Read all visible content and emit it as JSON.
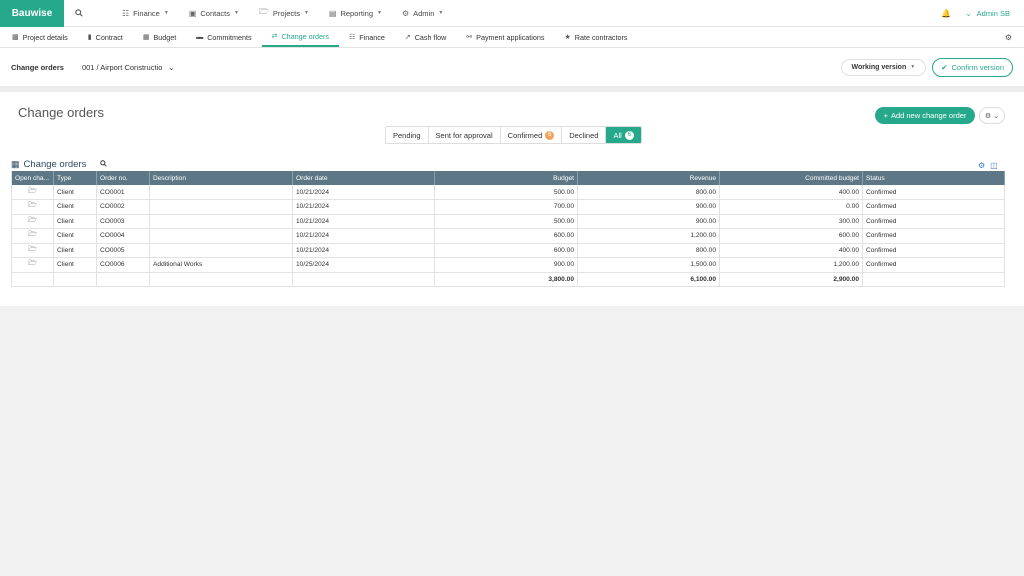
{
  "brand": "Bauwise",
  "nav": {
    "items": [
      {
        "label": "Finance",
        "icon": "book-icon"
      },
      {
        "label": "Contacts",
        "icon": "contacts-icon"
      },
      {
        "label": "Projects",
        "icon": "folder-icon"
      },
      {
        "label": "Reporting",
        "icon": "chart-icon"
      },
      {
        "label": "Admin",
        "icon": "gear-icon"
      }
    ],
    "user": "Admin SB"
  },
  "subnav": {
    "tabs": [
      {
        "label": "Project details"
      },
      {
        "label": "Contract"
      },
      {
        "label": "Budget"
      },
      {
        "label": "Commitments"
      },
      {
        "label": "Change orders",
        "active": true
      },
      {
        "label": "Finance"
      },
      {
        "label": "Cash flow"
      },
      {
        "label": "Payment applications"
      },
      {
        "label": "Rate contractors"
      }
    ]
  },
  "header": {
    "title": "Change orders",
    "project": "001 / Airport Constructio",
    "version": "Working version",
    "confirm": "Confirm version"
  },
  "page": {
    "title": "Change orders",
    "add_button": "Add new change order"
  },
  "filters": [
    {
      "label": "Pending"
    },
    {
      "label": "Sent for approval"
    },
    {
      "label": "Confirmed",
      "count": "6"
    },
    {
      "label": "Declined"
    },
    {
      "label": "All",
      "count": "6",
      "active": true
    }
  ],
  "grid": {
    "title": "Change orders",
    "columns": [
      "Open cha...",
      "Type",
      "Order no.",
      "Description",
      "Order date",
      "Budget",
      "Revenue",
      "Committed budget",
      "Status"
    ],
    "rows": [
      {
        "type": "Client",
        "order_no": "CO0001",
        "description": "",
        "date": "10/21/2024",
        "budget": "500.00",
        "revenue": "800.00",
        "committed": "400.00",
        "status": "Confirmed"
      },
      {
        "type": "Client",
        "order_no": "CO0002",
        "description": "",
        "date": "10/21/2024",
        "budget": "700.00",
        "revenue": "900.00",
        "committed": "0.00",
        "status": "Confirmed"
      },
      {
        "type": "Client",
        "order_no": "CO0003",
        "description": "",
        "date": "10/21/2024",
        "budget": "500.00",
        "revenue": "900.00",
        "committed": "300.00",
        "status": "Confirmed"
      },
      {
        "type": "Client",
        "order_no": "CO0004",
        "description": "",
        "date": "10/21/2024",
        "budget": "600.00",
        "revenue": "1,200.00",
        "committed": "600.00",
        "status": "Confirmed"
      },
      {
        "type": "Client",
        "order_no": "CO0005",
        "description": "",
        "date": "10/21/2024",
        "budget": "600.00",
        "revenue": "800.00",
        "committed": "400.00",
        "status": "Confirmed"
      },
      {
        "type": "Client",
        "order_no": "CO0006",
        "description": "Additional Works",
        "date": "10/25/2024",
        "budget": "900.00",
        "revenue": "1,500.00",
        "committed": "1,200.00",
        "status": "Confirmed"
      }
    ],
    "totals": {
      "budget": "3,800.00",
      "revenue": "6,100.00",
      "committed": "2,900.00"
    }
  },
  "colors": {
    "accent": "#26a98b",
    "header_bg": "#5e7786",
    "badge": "#f0a35a",
    "link": "#3a7ad1"
  }
}
